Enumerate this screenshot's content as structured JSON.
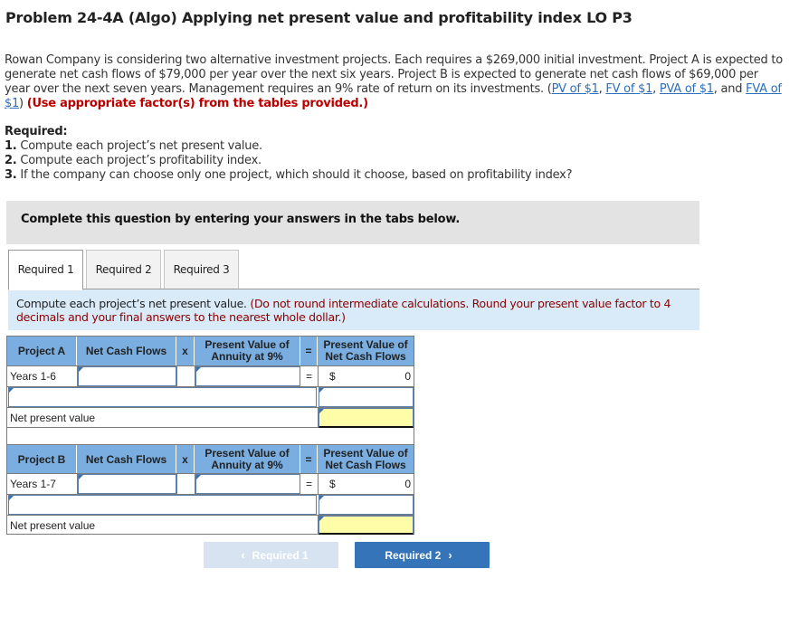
{
  "title": "Problem 24-4A (Algo) Applying net present value and profitability index LO P3",
  "intro": {
    "text": "Rowan Company is considering two alternative investment projects. Each requires a $269,000 initial investment. Project A is expected to generate net cash flows of $79,000 per year over the next six years. Project B is expected to generate net cash flows of $69,000 per year over the next seven years. Management requires an 9% rate of return on its investments. (",
    "links": [
      "PV of $1",
      "FV of $1",
      "PVA of $1",
      "FVA of $1"
    ],
    "sep1": ", ",
    "sep2": ", ",
    "sep3": ", and ",
    "close": ") ",
    "instruction": "(Use appropriate factor(s) from the tables provided.)"
  },
  "required": {
    "heading": "Required:",
    "items": [
      {
        "num": "1.",
        "text": " Compute each project’s net present value."
      },
      {
        "num": "2.",
        "text": " Compute each project’s profitability index."
      },
      {
        "num": "3.",
        "text": " If the company can choose only one project, which should it choose, based on profitability index?"
      }
    ]
  },
  "banner": "Complete this question by entering your answers in the tabs below.",
  "tabs": [
    {
      "label": "Required 1",
      "active": true
    },
    {
      "label": "Required 2",
      "active": false
    },
    {
      "label": "Required 3",
      "active": false
    }
  ],
  "note": {
    "text": "Compute each project’s net present value. ",
    "instruction": "(Do not round intermediate calculations. Round your present value factor to 4 decimals and your final answers to the nearest whole dollar.)"
  },
  "tables": [
    {
      "project": "Project A",
      "col_cash": "Net Cash Flows",
      "op_x": "x",
      "col_pv": "Present Value of Annuity at 9%",
      "op_eq": "=",
      "col_pvcf": "Present Value of Net Cash Flows",
      "row_label": "Years 1-6",
      "cash_value": "",
      "factor_value": "",
      "currency": "$",
      "pv_value": "0",
      "extra_label": "",
      "extra_value": "",
      "npv_label": "Net present value",
      "npv_value": ""
    },
    {
      "project": "Project B",
      "col_cash": "Net Cash Flows",
      "op_x": "x",
      "col_pv": "Present Value of Annuity at 9%",
      "op_eq": "=",
      "col_pvcf": "Present Value of Net Cash Flows",
      "row_label": "Years 1-7",
      "cash_value": "",
      "factor_value": "",
      "currency": "$",
      "pv_value": "0",
      "extra_label": "",
      "extra_value": "",
      "npv_label": "Net present value",
      "npv_value": ""
    }
  ],
  "nav": {
    "prev_label": "Required 1",
    "next_label": "Required 2",
    "prev_icon": "‹",
    "next_icon": "›"
  }
}
